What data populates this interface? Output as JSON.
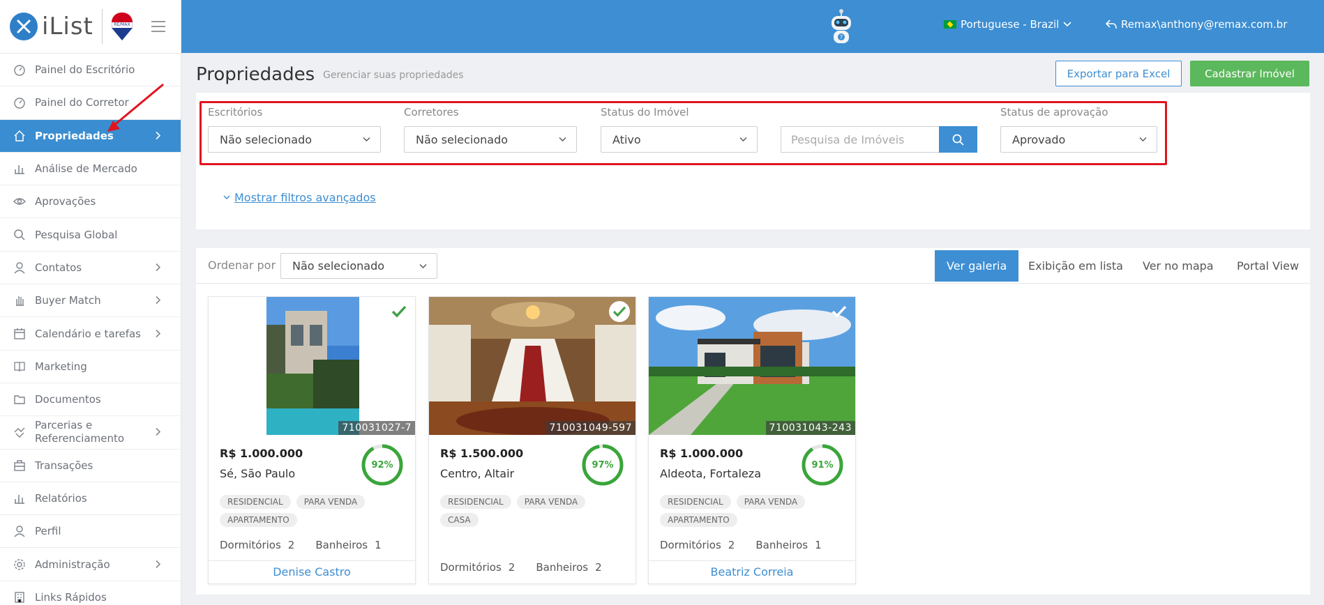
{
  "brand": {
    "logo_text": "iList",
    "remax_label": "RE/MAX"
  },
  "sidebar": {
    "items": [
      {
        "label": "Painel do Escritório",
        "icon": "gauge-icon",
        "chevron": false,
        "active": false
      },
      {
        "label": "Painel do Corretor",
        "icon": "gauge-icon",
        "chevron": false,
        "active": false
      },
      {
        "label": "Propriedades",
        "icon": "home-icon",
        "chevron": true,
        "active": true
      },
      {
        "label": "Análise de Mercado",
        "icon": "bar-chart-icon",
        "chevron": false,
        "active": false
      },
      {
        "label": "Aprovações",
        "icon": "eye-icon",
        "chevron": false,
        "active": false
      },
      {
        "label": "Pesquisa Global",
        "icon": "search-icon",
        "chevron": false,
        "active": false
      },
      {
        "label": "Contatos",
        "icon": "user-icon",
        "chevron": true,
        "active": false
      },
      {
        "label": "Buyer Match",
        "icon": "hand-icon",
        "chevron": true,
        "active": false
      },
      {
        "label": "Calendário e tarefas",
        "icon": "calendar-icon",
        "chevron": true,
        "active": false
      },
      {
        "label": "Marketing",
        "icon": "book-icon",
        "chevron": false,
        "active": false
      },
      {
        "label": "Documentos",
        "icon": "folder-icon",
        "chevron": false,
        "active": false
      },
      {
        "label": "Parcerias e Referenciamento",
        "icon": "handshake-icon",
        "chevron": true,
        "active": false
      },
      {
        "label": "Transações",
        "icon": "briefcase-icon",
        "chevron": false,
        "active": false
      },
      {
        "label": "Relatórios",
        "icon": "bar-chart-icon",
        "chevron": false,
        "active": false
      },
      {
        "label": "Perfil",
        "icon": "user-icon",
        "chevron": false,
        "active": false
      },
      {
        "label": "Administração",
        "icon": "gear-icon",
        "chevron": true,
        "active": false
      },
      {
        "label": "Links Rápidos",
        "icon": "building-icon",
        "chevron": false,
        "active": false
      }
    ]
  },
  "header": {
    "language": "Portuguese - Brazil",
    "user": "Remax\\anthony@remax.com.br"
  },
  "page": {
    "title": "Propriedades",
    "subtitle": "Gerenciar suas propriedades",
    "export_label": "Exportar para Excel",
    "add_label": "Cadastrar Imóvel"
  },
  "filters": {
    "escritorios": {
      "label": "Escritórios",
      "value": "Não selecionado"
    },
    "corretores": {
      "label": "Corretores",
      "value": "Não selecionado"
    },
    "status": {
      "label": "Status do Imóvel",
      "value": "Ativo"
    },
    "search_placeholder": "Pesquisa de Imóveis",
    "aprovacao": {
      "label": "Status de aprovação",
      "value": "Aprovado"
    },
    "advanced_link": "Mostrar filtros avançados"
  },
  "results": {
    "sort_label": "Ordenar por",
    "sort_value": "Não selecionado",
    "views": [
      "Ver galeria",
      "Exibição em lista",
      "Ver no mapa",
      "Portal View"
    ],
    "active_view": 0
  },
  "properties": [
    {
      "id": "710031027-7",
      "price": "R$ 1.000.000",
      "location": "Sé, São Paulo",
      "score": 0.92,
      "score_text": "92%",
      "tags": [
        "RESIDENCIAL",
        "PARA VENDA",
        "APARTAMENTO"
      ],
      "dorm_label": "Dormitórios",
      "dorm": "2",
      "bath_label": "Banheiros",
      "bath": "1",
      "agent": "Denise Castro"
    },
    {
      "id": "710031049-597",
      "price": "R$ 1.500.000",
      "location": "Centro, Altair",
      "score": 0.97,
      "score_text": "97%",
      "tags": [
        "RESIDENCIAL",
        "PARA VENDA",
        "CASA"
      ],
      "dorm_label": "Dormitórios",
      "dorm": "2",
      "bath_label": "Banheiros",
      "bath": "2",
      "agent": ""
    },
    {
      "id": "710031043-243",
      "price": "R$ 1.000.000",
      "location": "Aldeota, Fortaleza",
      "score": 0.91,
      "score_text": "91%",
      "tags": [
        "RESIDENCIAL",
        "PARA VENDA",
        "APARTAMENTO"
      ],
      "dorm_label": "Dormitórios",
      "dorm": "2",
      "bath_label": "Banheiros",
      "bath": "1",
      "agent": "Beatriz Correia"
    }
  ],
  "colors": {
    "primary": "#3d8ed2",
    "success": "#5cb85c",
    "score_ring": "#3aa53a",
    "highlight": "#e0141e"
  }
}
